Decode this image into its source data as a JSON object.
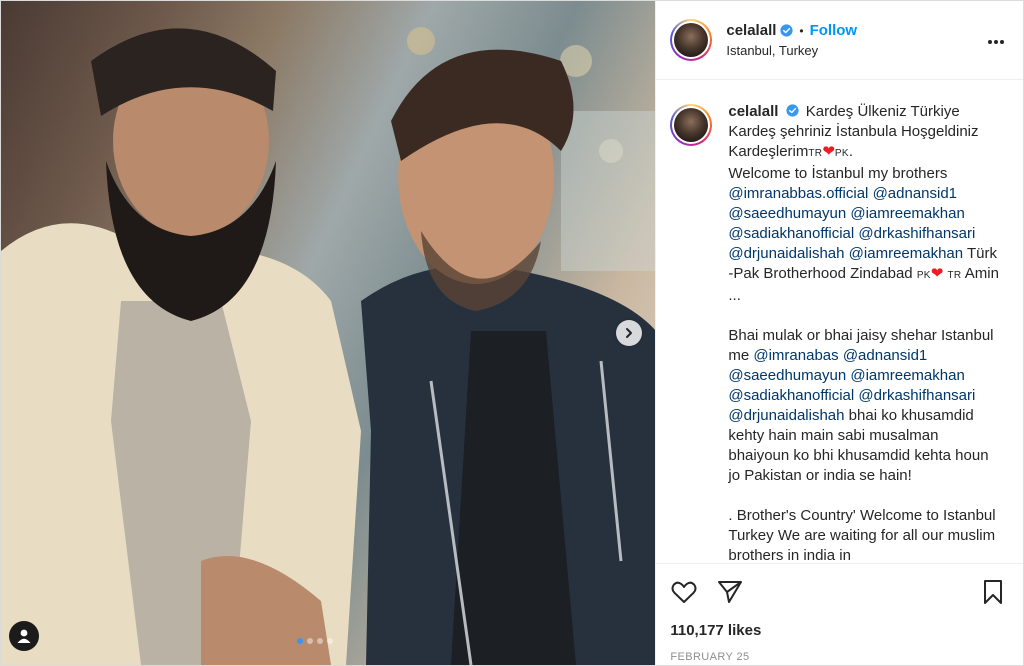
{
  "post": {
    "header": {
      "username": "celalall",
      "separator": "•",
      "follow_label": "Follow",
      "location": "Istanbul, Turkey"
    },
    "caption": {
      "username": "celalall",
      "segments": [
        {
          "type": "text",
          "text": "Kardeş Ülkeniz Türkiye Kardeş şehriniz İstanbula Hoşgeldiniz Kardeşlerim"
        },
        {
          "type": "flag",
          "text": "TR"
        },
        {
          "type": "heart",
          "text": "❤"
        },
        {
          "type": "flag",
          "text": "PK"
        },
        {
          "type": "text",
          "text": "."
        },
        {
          "type": "br"
        },
        {
          "type": "text",
          "text": "Welcome to İstanbul my brothers "
        },
        {
          "type": "mention",
          "text": "@imranabbas.official"
        },
        {
          "type": "text",
          "text": " "
        },
        {
          "type": "mention",
          "text": "@adnansid1"
        },
        {
          "type": "text",
          "text": " "
        },
        {
          "type": "mention",
          "text": "@saeedhumayun"
        },
        {
          "type": "text",
          "text": " "
        },
        {
          "type": "mention",
          "text": "@iamreemakhan"
        },
        {
          "type": "text",
          "text": " "
        },
        {
          "type": "mention",
          "text": "@sadiakhanofficial"
        },
        {
          "type": "text",
          "text": " "
        },
        {
          "type": "mention",
          "text": "@drkashifhansari"
        },
        {
          "type": "text",
          "text": " "
        },
        {
          "type": "mention",
          "text": "@drjunaidalishah"
        },
        {
          "type": "text",
          "text": " "
        },
        {
          "type": "mention",
          "text": "@iamreemakhan"
        },
        {
          "type": "text",
          "text": " Türk -Pak Brotherhood Zindabad "
        },
        {
          "type": "flag",
          "text": "PK"
        },
        {
          "type": "heart",
          "text": "❤"
        },
        {
          "type": "text",
          "text": " "
        },
        {
          "type": "flag",
          "text": "TR"
        },
        {
          "type": "text",
          "text": " Amin ..."
        },
        {
          "type": "br"
        },
        {
          "type": "br"
        },
        {
          "type": "text",
          "text": "Bhai mulak or bhai jaisy shehar Istanbul me "
        },
        {
          "type": "mention",
          "text": "@imranabas"
        },
        {
          "type": "text",
          "text": " "
        },
        {
          "type": "mention",
          "text": "@adnansid1"
        },
        {
          "type": "text",
          "text": " "
        },
        {
          "type": "mention",
          "text": "@saeedhumayun"
        },
        {
          "type": "text",
          "text": " "
        },
        {
          "type": "mention",
          "text": "@iamreemakhan"
        },
        {
          "type": "text",
          "text": " "
        },
        {
          "type": "mention",
          "text": "@sadiakhanofficial"
        },
        {
          "type": "text",
          "text": " "
        },
        {
          "type": "mention",
          "text": "@drkashifhansari"
        },
        {
          "type": "text",
          "text": " "
        },
        {
          "type": "mention",
          "text": "@drjunaidalishah"
        },
        {
          "type": "text",
          "text": " bhai ko khusamdid kehty hain main sabi musalman bhaiyoun ko bhi khusamdid kehta houn jo Pakistan or india se hain!"
        },
        {
          "type": "br"
        },
        {
          "type": "br"
        },
        {
          "type": "text",
          "text": ". Brother's Country' Welcome to Istanbul Turkey We are waiting for all our muslim brothers in india in"
        }
      ]
    },
    "likes_text": "110,177 likes",
    "date_text": "FEBRUARY 25",
    "carousel": {
      "total": 4,
      "active_index": 0
    }
  },
  "colors": {
    "accent": "#0095f6",
    "mention": "#00376b",
    "heart": "#ed1c24",
    "dot_active": "#3897f0"
  }
}
